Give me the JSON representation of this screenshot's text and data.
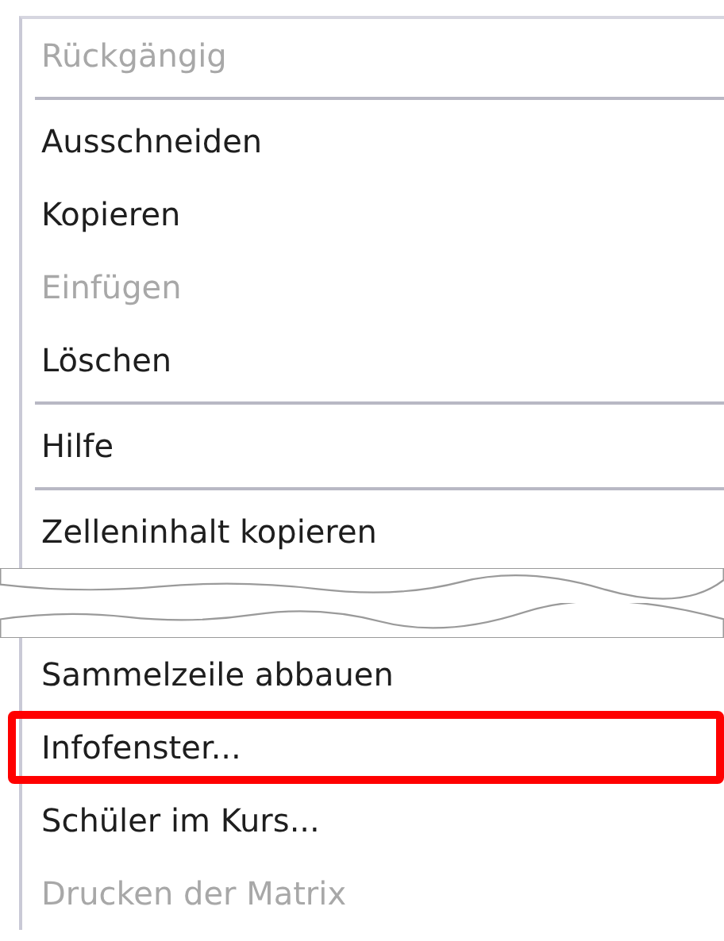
{
  "fragments": [
    {
      "items": [
        {
          "kind": "item",
          "label": "Rückgängig",
          "disabled": true,
          "highlighted": false
        },
        {
          "kind": "separator"
        },
        {
          "kind": "item",
          "label": "Ausschneiden",
          "disabled": false,
          "highlighted": false
        },
        {
          "kind": "item",
          "label": "Kopieren",
          "disabled": false,
          "highlighted": false
        },
        {
          "kind": "item",
          "label": "Einfügen",
          "disabled": true,
          "highlighted": false
        },
        {
          "kind": "item",
          "label": "Löschen",
          "disabled": false,
          "highlighted": false
        },
        {
          "kind": "separator"
        },
        {
          "kind": "item",
          "label": "Hilfe",
          "disabled": false,
          "highlighted": false
        },
        {
          "kind": "separator"
        },
        {
          "kind": "item",
          "label": "Zelleninhalt kopieren",
          "disabled": false,
          "highlighted": false
        }
      ]
    },
    {
      "items": [
        {
          "kind": "item",
          "label": "Sammelzeile abbauen",
          "disabled": false,
          "highlighted": false
        },
        {
          "kind": "item",
          "label": "Infofenster...",
          "disabled": false,
          "highlighted": true
        },
        {
          "kind": "item",
          "label": "Schüler im Kurs...",
          "disabled": false,
          "highlighted": false
        },
        {
          "kind": "item",
          "label": "Drucken der Matrix",
          "disabled": true,
          "highlighted": false
        }
      ]
    }
  ]
}
